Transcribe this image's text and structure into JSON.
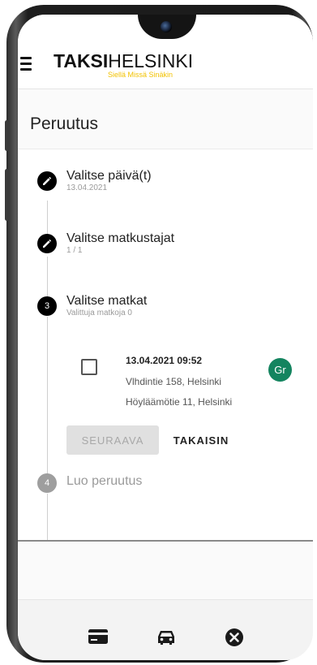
{
  "header": {
    "logo_bold": "TAKSI",
    "logo_light": "HELSINKI",
    "tagline": "Siellä Missä Sinäkin"
  },
  "page": {
    "title": "Peruutus"
  },
  "steps": [
    {
      "title": "Valitse päivä(t)",
      "subtitle": "13.04.2021",
      "icon": "pencil-icon"
    },
    {
      "title": "Valitse matkustajat",
      "subtitle": "1 / 1",
      "icon": "pencil-icon"
    },
    {
      "title": "Valitse matkat",
      "subtitle": "Valittuja matkoja 0",
      "number": "3"
    },
    {
      "title": "Luo peruutus",
      "number": "4"
    }
  ],
  "trip": {
    "datetime": "13.04.2021 09:52",
    "from": "Vlhdintie 158, Helsinki",
    "to": "Höyläämötie 11, Helsinki",
    "avatar": "Gr",
    "checked": false
  },
  "buttons": {
    "next": "SEURAAVA",
    "back": "TAKAISIN"
  },
  "bottom_nav": [
    {
      "icon": "credit-card-icon"
    },
    {
      "icon": "car-icon"
    },
    {
      "icon": "cancel-circle-icon"
    }
  ],
  "colors": {
    "brand_yellow": "#f2c200",
    "avatar_green": "#14845f",
    "active_step": "#000000",
    "inactive_step": "#9e9e9e"
  }
}
